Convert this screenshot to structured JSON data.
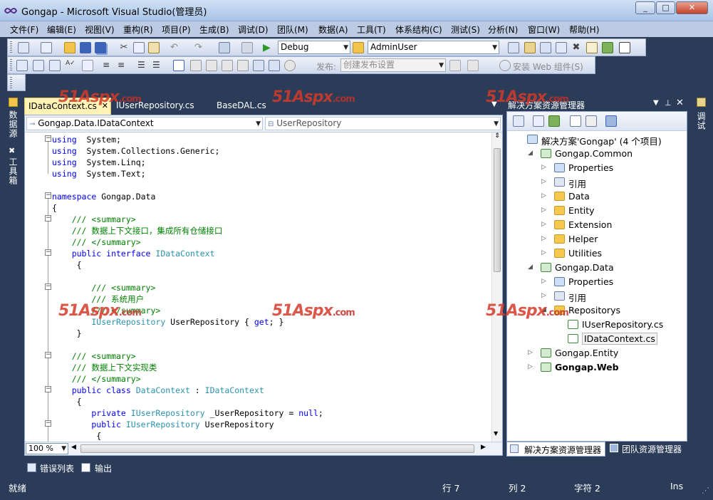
{
  "window": {
    "title": "Gongap - Microsoft Visual Studio(管理员)"
  },
  "menu": [
    "文件(F)",
    "编辑(E)",
    "视图(V)",
    "重构(R)",
    "项目(P)",
    "生成(B)",
    "调试(D)",
    "团队(M)",
    "数据(A)",
    "工具(T)",
    "体系结构(C)",
    "测试(S)",
    "分析(N)",
    "窗口(W)",
    "帮助(H)"
  ],
  "toolbar": {
    "config": "Debug",
    "platform": "AdminUser",
    "publish_label": "发布:",
    "publish_value": "创建发布设置",
    "install_web": "安装 Web 组件(S)"
  },
  "left_rail": {
    "data_source": "数据源",
    "toolbox": "工具箱"
  },
  "right_rail": {
    "debug": "调试"
  },
  "editor": {
    "tabs": [
      "IDataContext.cs",
      "IUserRepository.cs",
      "BaseDAL.cs"
    ],
    "nav_left": "Gongap.Data.IDataContext",
    "nav_right": "UserRepository",
    "zoom": "100 %",
    "lines": [
      [
        [
          "kw",
          "using"
        ],
        [
          "",
          "  System;"
        ]
      ],
      [
        [
          "kw",
          "using"
        ],
        [
          "",
          "  System.Collections.Generic;"
        ]
      ],
      [
        [
          "kw",
          "using"
        ],
        [
          "",
          "  System.Linq;"
        ]
      ],
      [
        [
          "kw",
          "using"
        ],
        [
          "",
          "  System.Text;"
        ]
      ],
      [],
      [
        [
          "kw",
          "namespace"
        ],
        [
          "",
          " Gongap.Data"
        ]
      ],
      [
        [
          "",
          "{"
        ]
      ],
      [
        [
          "cm",
          "    /// <summary>"
        ]
      ],
      [
        [
          "cm",
          "    /// 数据上下文接口，集成所有仓储接口"
        ]
      ],
      [
        [
          "cm",
          "    /// </summary>"
        ]
      ],
      [
        [
          "kw",
          "    public interface"
        ],
        [
          "ty",
          " IDataContext"
        ]
      ],
      [
        [
          "",
          "     {"
        ]
      ],
      [],
      [
        [
          "cm",
          "        /// <summary>"
        ]
      ],
      [
        [
          "cm",
          "        /// 系统用户"
        ]
      ],
      [
        [
          "cm",
          "        /// </summary>"
        ]
      ],
      [
        [
          "ty",
          "        IUserRepository"
        ],
        [
          "",
          " UserRepository { "
        ],
        [
          "kw",
          "get"
        ],
        [
          "",
          "; }"
        ]
      ],
      [
        [
          "",
          "     }"
        ]
      ],
      [],
      [
        [
          "cm",
          "    /// <summary>"
        ]
      ],
      [
        [
          "cm",
          "    /// 数据上下文实现类"
        ]
      ],
      [
        [
          "cm",
          "    /// </summary>"
        ]
      ],
      [
        [
          "kw",
          "    public class"
        ],
        [
          "ty",
          " DataContext"
        ],
        [
          "",
          " : "
        ],
        [
          "ty",
          "IDataContext"
        ]
      ],
      [
        [
          "",
          "     {"
        ]
      ],
      [
        [
          "kw",
          "        private"
        ],
        [
          "ty",
          " IUserRepository"
        ],
        [
          "",
          " _UserRepository = "
        ],
        [
          "kw",
          "null"
        ],
        [
          "",
          ";"
        ]
      ],
      [
        [
          "kw",
          "        public"
        ],
        [
          "ty",
          " IUserRepository"
        ],
        [
          "",
          " UserRepository"
        ]
      ],
      [
        [
          "",
          "         {"
        ]
      ]
    ]
  },
  "solution_explorer": {
    "title": "解决方案资源管理器",
    "items": [
      {
        "label": "解决方案'Gongap' (4 个项目)",
        "icon": "solution-icon"
      },
      {
        "label": "Gongap.Common",
        "icon": "project-icon"
      },
      {
        "label": "Properties",
        "icon": "properties-icon"
      },
      {
        "label": "引用",
        "icon": "references-icon"
      },
      {
        "label": "Data",
        "icon": "folder-icon"
      },
      {
        "label": "Entity",
        "icon": "folder-icon"
      },
      {
        "label": "Extension",
        "icon": "folder-icon"
      },
      {
        "label": "Helper",
        "icon": "folder-icon"
      },
      {
        "label": "Utilities",
        "icon": "folder-icon"
      },
      {
        "label": "Gongap.Data",
        "icon": "project-icon"
      },
      {
        "label": "Properties",
        "icon": "properties-icon"
      },
      {
        "label": "引用",
        "icon": "references-icon"
      },
      {
        "label": "Repositorys",
        "icon": "folder-icon"
      },
      {
        "label": "IUserRepository.cs",
        "icon": "csharp-file-icon"
      },
      {
        "label": "IDataContext.cs",
        "icon": "csharp-file-icon"
      },
      {
        "label": "Gongap.Entity",
        "icon": "project-icon"
      },
      {
        "label": "Gongap.Web",
        "icon": "web-project-icon"
      }
    ],
    "tabs": [
      "解决方案资源管理器",
      "团队资源管理器"
    ]
  },
  "bottom_tabs": [
    "错误列表",
    "输出"
  ],
  "status": {
    "ready": "就绪",
    "line": "行 7",
    "col": "列 2",
    "char": "字符 2",
    "ins": "Ins"
  },
  "watermark": {
    "brand": "51Aspx",
    "suffix": ".com"
  },
  "colors": {
    "chrome": "#2b3c59",
    "active_tab": "#fff3b5",
    "keyword": "#0000ff",
    "comment": "#008000",
    "type": "#2b91af"
  }
}
